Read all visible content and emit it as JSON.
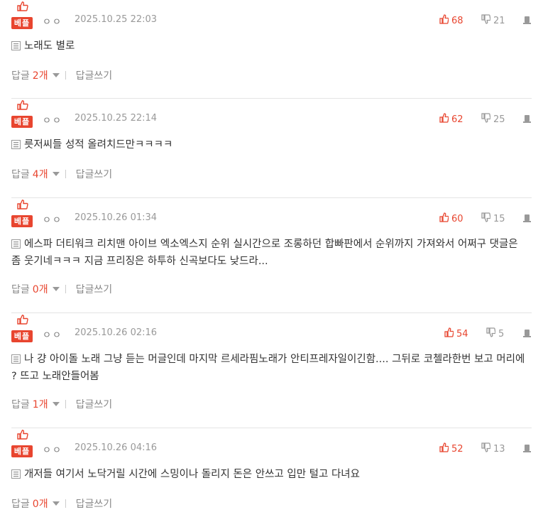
{
  "best_label": "베플",
  "reply_label": "답글",
  "count_unit": "개",
  "write_reply_label": "답글쓰기",
  "comments": [
    {
      "nickname": "ㅇㅇ",
      "date": "2025.10.25 22:03",
      "likes": "68",
      "dislikes": "21",
      "text": "노래도 별로",
      "reply_count": "2"
    },
    {
      "nickname": "ㅇㅇ",
      "date": "2025.10.25 22:14",
      "likes": "62",
      "dislikes": "25",
      "text": "릇저씨들 성적 올려치드만ㅋㅋㅋㅋ",
      "reply_count": "4"
    },
    {
      "nickname": "ㅇㅇ",
      "date": "2025.10.26 01:34",
      "likes": "60",
      "dislikes": "15",
      "text": "에스파 더티워크 리치맨 아이브 엑소엑스지 순위 실시간으로 조롱하던 합빠판에서 순위까지 가져와서 어쩌구 댓글은 좀 웃기네ㅋㅋㅋ 지금 프리징은 하투하 신곡보다도 낮드라...",
      "reply_count": "0"
    },
    {
      "nickname": "ㅇㅇ",
      "date": "2025.10.26 02:16",
      "likes": "54",
      "dislikes": "5",
      "text": "나 걍 아이돌 노래 그냥 듣는 머글인데 마지막 르세라핌노래가 안티프레자일이긴함.... 그뒤로 코첼라한번 보고 머리에 ? 뜨고 노래안들어봄",
      "reply_count": "1"
    },
    {
      "nickname": "ㅇㅇ",
      "date": "2025.10.26 04:16",
      "likes": "52",
      "dislikes": "13",
      "text": "개저들 여기서 노닥거릴 시간에 스밍이나 돌리지 돈은 안쓰고 입만 털고 다녀요",
      "reply_count": "0"
    }
  ]
}
